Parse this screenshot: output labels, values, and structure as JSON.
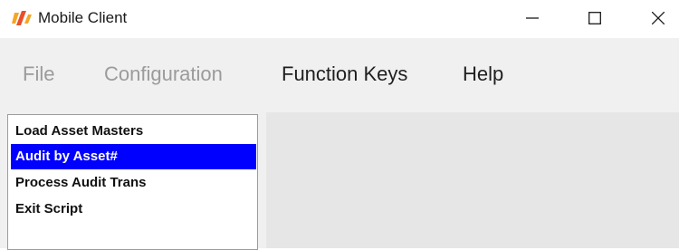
{
  "window": {
    "title": "Mobile Client",
    "controls": [
      "minimize-icon",
      "maximize-icon",
      "close-icon"
    ],
    "logo_colors": [
      "#e8502a",
      "#f5a623"
    ]
  },
  "menu": {
    "file": "File",
    "configuration": "Configuration",
    "function_keys": "Function Keys",
    "help": "Help"
  },
  "list": {
    "items": [
      {
        "label": "Load Asset Masters",
        "selected": false
      },
      {
        "label": "Audit by Asset#",
        "selected": true
      },
      {
        "label": "Process Audit Trans",
        "selected": false
      },
      {
        "label": "Exit Script",
        "selected": false
      }
    ],
    "selection_color": "#0000ff"
  }
}
